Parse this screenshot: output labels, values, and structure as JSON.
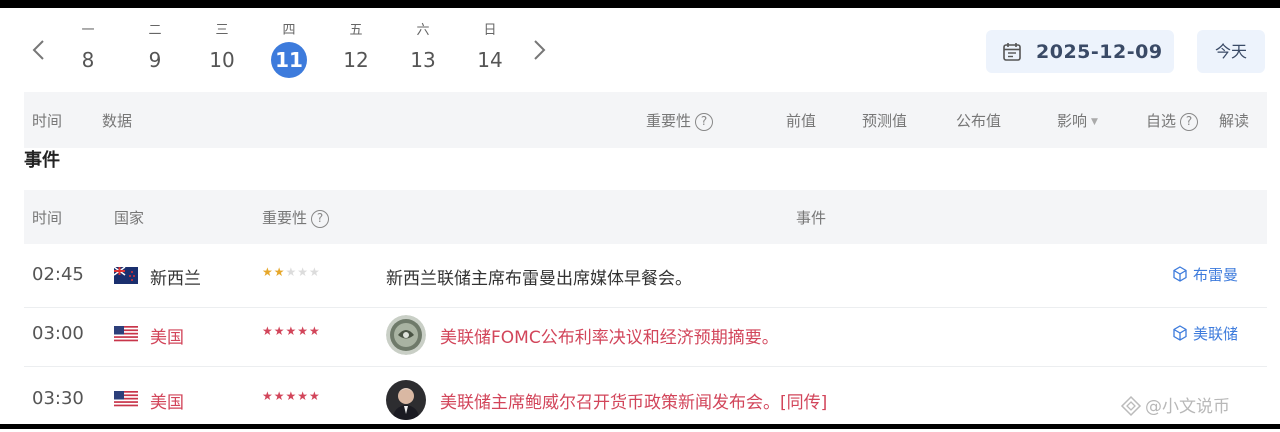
{
  "week": {
    "days": [
      {
        "weekday": "一",
        "day": "8"
      },
      {
        "weekday": "二",
        "day": "9"
      },
      {
        "weekday": "三",
        "day": "10"
      },
      {
        "weekday": "四",
        "day": "11"
      },
      {
        "weekday": "五",
        "day": "12"
      },
      {
        "weekday": "六",
        "day": "13"
      },
      {
        "weekday": "日",
        "day": "14"
      }
    ],
    "active_index": 3
  },
  "date_picker": {
    "value": "2025-12-09"
  },
  "today_button": "今天",
  "data_table": {
    "headers": {
      "time": "时间",
      "data": "数据",
      "importance": "重要性",
      "previous": "前值",
      "forecast": "预测值",
      "actual": "公布值",
      "impact": "影响",
      "watchlist": "自选",
      "interpret": "解读"
    }
  },
  "events_section": {
    "title": "事件",
    "headers": {
      "time": "时间",
      "country": "国家",
      "importance": "重要性",
      "event": "事件"
    },
    "rows": [
      {
        "time": "02:45",
        "country": "新西兰",
        "stars": 2,
        "event": "新西兰联储主席布雷曼出席媒体早餐会。",
        "tag": "布雷曼",
        "highlight": false
      },
      {
        "time": "03:00",
        "country": "美国",
        "stars": 5,
        "event": "美联储FOMC公布利率决议和经济预期摘要。",
        "tag": "美联储",
        "highlight": true
      },
      {
        "time": "03:30",
        "country": "美国",
        "stars": 5,
        "event": "美联储主席鲍威尔召开货币政策新闻发布会。[同传]",
        "tag": "",
        "highlight": true
      }
    ]
  },
  "watermark": "@小文说币",
  "colors": {
    "accent": "#3d7bdc",
    "highlight_red": "#d2455a",
    "star_gold": "#e6a72a"
  }
}
